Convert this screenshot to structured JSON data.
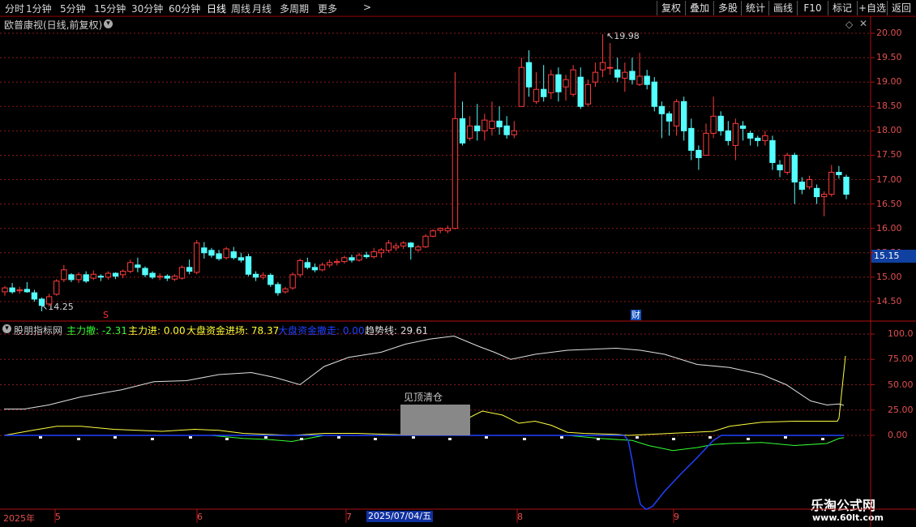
{
  "toolbar": {
    "periods": [
      "分时",
      "1分钟",
      "5分钟",
      "15分钟",
      "30分钟",
      "60分钟",
      "日线",
      "周线",
      "月线",
      "多周期",
      "更多"
    ],
    "active": "日线",
    "more_arrow": ">",
    "right_buttons": [
      "复权",
      "叠加",
      "多股",
      "统计",
      "画线",
      "F10",
      "标记",
      "+自选",
      "返回"
    ]
  },
  "main_chart": {
    "title": "欧普康视(日线,前复权)",
    "price_axis": [
      "20.00",
      "19.50",
      "19.00",
      "18.50",
      "18.00",
      "17.50",
      "17.00",
      "16.50",
      "16.00",
      "15.50",
      "15.00",
      "14.50"
    ],
    "current_price": "15.15",
    "high_label": "19.98",
    "low_label": "14.25",
    "badge_fin": "财",
    "badge_s": "S"
  },
  "indicator": {
    "name": "股朋指标网",
    "items": [
      {
        "label": "主力撤:",
        "value": "-2.31",
        "color": "#33ff33"
      },
      {
        "label": "主力进:",
        "value": "0.00",
        "color": "#ffff33"
      },
      {
        "label": "大盘资金进场:",
        "value": "78.37",
        "color": "#ffff33"
      },
      {
        "label": "大盘资金撤走:",
        "value": "0.00",
        "color": "#2040ff"
      },
      {
        "label": "趋势线:",
        "value": "29.61",
        "color": "#e0e0e0"
      }
    ],
    "axis": [
      "100.0",
      "75.00",
      "50.00",
      "25.00",
      "0.00"
    ],
    "signal_text": "见顶清仓"
  },
  "x_axis": {
    "labels": [
      "2025年",
      "5",
      "6",
      "7",
      "8",
      "9"
    ],
    "selected_date": "2025/07/04/五"
  },
  "watermark": {
    "title": "乐淘公式网",
    "url": "www.60lt.com"
  },
  "colors": {
    "up": "#ff3b3b",
    "down": "#54ffff",
    "grid": "#8a1a1a",
    "trend": "#e0e0e0"
  },
  "chart_data": {
    "type": "candlestick",
    "title": "欧普康视(日线,前复权)",
    "ylim": [
      14.1,
      20.25
    ],
    "candles": [
      [
        14.7,
        14.78,
        14.82,
        14.62
      ],
      [
        14.78,
        14.7,
        14.88,
        14.66
      ],
      [
        14.72,
        14.74,
        14.8,
        14.66
      ],
      [
        14.75,
        14.7,
        14.9,
        14.68
      ],
      [
        14.68,
        14.55,
        14.74,
        14.5
      ],
      [
        14.55,
        14.42,
        14.58,
        14.3
      ],
      [
        14.45,
        14.6,
        14.66,
        14.4
      ],
      [
        14.65,
        14.92,
        14.96,
        14.62
      ],
      [
        14.95,
        15.15,
        15.25,
        14.9
      ],
      [
        15.05,
        14.95,
        15.08,
        14.9
      ],
      [
        14.95,
        15.05,
        15.1,
        14.88
      ],
      [
        15.05,
        14.92,
        15.12,
        14.88
      ],
      [
        14.98,
        15.06,
        15.14,
        14.94
      ],
      [
        15.02,
        15.0,
        15.06,
        14.92
      ],
      [
        15.0,
        15.08,
        15.12,
        14.95
      ],
      [
        15.08,
        15.02,
        15.1,
        14.96
      ],
      [
        15.05,
        15.12,
        15.16,
        14.98
      ],
      [
        15.12,
        15.3,
        15.36,
        15.08
      ],
      [
        15.25,
        15.2,
        15.4,
        15.1
      ],
      [
        15.18,
        15.05,
        15.22,
        15.0
      ],
      [
        15.08,
        15.0,
        15.12,
        14.96
      ],
      [
        15.0,
        15.02,
        15.08,
        14.94
      ],
      [
        15.02,
        14.98,
        15.06,
        14.92
      ],
      [
        14.96,
        15.02,
        15.06,
        14.92
      ],
      [
        14.98,
        15.2,
        15.24,
        14.95
      ],
      [
        15.2,
        15.12,
        15.36,
        15.06
      ],
      [
        15.1,
        15.7,
        15.76,
        15.06
      ],
      [
        15.6,
        15.5,
        15.72,
        15.38
      ],
      [
        15.55,
        15.45,
        15.6,
        15.4
      ],
      [
        15.48,
        15.38,
        15.56,
        15.34
      ],
      [
        15.4,
        15.58,
        15.62,
        15.36
      ],
      [
        15.52,
        15.4,
        15.62,
        15.36
      ],
      [
        15.4,
        15.35,
        15.5,
        15.3
      ],
      [
        15.42,
        15.06,
        15.48,
        15.02
      ],
      [
        15.06,
        15.0,
        15.12,
        14.92
      ],
      [
        15.0,
        15.04,
        15.1,
        14.95
      ],
      [
        15.04,
        14.85,
        15.08,
        14.8
      ],
      [
        14.85,
        14.68,
        14.9,
        14.62
      ],
      [
        14.7,
        14.76,
        14.8,
        14.66
      ],
      [
        14.78,
        15.05,
        15.1,
        14.74
      ],
      [
        15.05,
        15.34,
        15.38,
        15.0
      ],
      [
        15.3,
        15.2,
        15.4,
        15.16
      ],
      [
        15.2,
        15.15,
        15.28,
        15.1
      ],
      [
        15.15,
        15.25,
        15.3,
        15.12
      ],
      [
        15.25,
        15.3,
        15.36,
        15.2
      ],
      [
        15.3,
        15.32,
        15.38,
        15.24
      ],
      [
        15.32,
        15.4,
        15.44,
        15.28
      ],
      [
        15.4,
        15.35,
        15.46,
        15.3
      ],
      [
        15.35,
        15.45,
        15.5,
        15.32
      ],
      [
        15.45,
        15.42,
        15.52,
        15.38
      ],
      [
        15.42,
        15.52,
        15.6,
        15.38
      ],
      [
        15.5,
        15.56,
        15.6,
        15.4
      ],
      [
        15.55,
        15.7,
        15.76,
        15.5
      ],
      [
        15.6,
        15.64,
        15.7,
        15.54
      ],
      [
        15.64,
        15.7,
        15.74,
        15.58
      ],
      [
        15.7,
        15.62,
        15.72,
        15.36
      ],
      [
        15.56,
        15.62,
        15.66,
        15.52
      ],
      [
        15.62,
        15.84,
        15.88,
        15.6
      ],
      [
        15.84,
        15.95,
        15.98,
        15.82
      ],
      [
        15.96,
        16.0,
        16.02,
        15.9
      ],
      [
        15.95,
        16.0,
        16.06,
        15.9
      ],
      [
        16.0,
        18.25,
        19.2,
        15.98
      ],
      [
        18.25,
        17.75,
        18.6,
        17.7
      ],
      [
        17.85,
        18.1,
        18.3,
        17.8
      ],
      [
        18.1,
        18.0,
        18.55,
        17.8
      ],
      [
        18.0,
        18.22,
        18.35,
        17.8
      ],
      [
        18.05,
        18.2,
        18.6,
        17.9
      ],
      [
        18.2,
        18.08,
        18.5,
        17.92
      ],
      [
        18.1,
        17.92,
        18.3,
        17.84
      ],
      [
        17.92,
        18.0,
        18.2,
        17.85
      ],
      [
        18.5,
        19.3,
        19.5,
        18.5
      ],
      [
        19.4,
        18.9,
        19.65,
        18.7
      ],
      [
        18.6,
        18.85,
        19.2,
        18.55
      ],
      [
        18.85,
        18.7,
        19.35,
        18.6
      ],
      [
        18.78,
        19.15,
        19.25,
        18.65
      ],
      [
        19.15,
        18.8,
        19.3,
        18.6
      ],
      [
        18.9,
        19.05,
        19.15,
        18.62
      ],
      [
        18.75,
        19.25,
        19.35,
        18.7
      ],
      [
        19.1,
        18.5,
        19.3,
        18.45
      ],
      [
        18.55,
        18.95,
        19.05,
        18.5
      ],
      [
        19.0,
        19.2,
        19.4,
        18.9
      ],
      [
        19.25,
        19.4,
        19.98,
        19.1
      ],
      [
        19.3,
        19.3,
        19.8,
        19.15
      ],
      [
        19.25,
        19.1,
        19.5,
        19.0
      ],
      [
        19.08,
        19.2,
        19.4,
        18.8
      ],
      [
        19.22,
        19.05,
        19.5,
        18.95
      ],
      [
        18.95,
        19.12,
        19.6,
        18.92
      ],
      [
        19.12,
        18.95,
        19.25,
        18.85
      ],
      [
        19.0,
        18.5,
        19.1,
        18.4
      ],
      [
        18.5,
        18.35,
        18.6,
        17.85
      ],
      [
        18.35,
        18.2,
        18.4,
        17.9
      ],
      [
        18.1,
        18.6,
        18.65,
        17.9
      ],
      [
        18.6,
        18.0,
        18.7,
        17.8
      ],
      [
        18.05,
        17.6,
        18.25,
        17.4
      ],
      [
        17.6,
        17.45,
        17.7,
        17.2
      ],
      [
        17.5,
        17.95,
        18.15,
        17.5
      ],
      [
        17.95,
        18.3,
        18.7,
        17.85
      ],
      [
        18.3,
        18.0,
        18.4,
        17.9
      ],
      [
        18.0,
        17.8,
        18.2,
        17.7
      ],
      [
        17.7,
        18.15,
        18.25,
        17.4
      ],
      [
        18.1,
        18.05,
        18.2,
        17.8
      ],
      [
        17.95,
        17.85,
        18.0,
        17.7
      ],
      [
        17.85,
        17.8,
        17.9,
        17.68
      ],
      [
        17.8,
        17.9,
        18.0,
        17.7
      ],
      [
        17.8,
        17.35,
        17.9,
        17.2
      ],
      [
        17.3,
        17.2,
        17.4,
        17.05
      ],
      [
        17.15,
        17.5,
        17.55,
        17.1
      ],
      [
        17.5,
        16.95,
        17.55,
        16.5
      ],
      [
        16.95,
        16.8,
        17.05,
        16.7
      ],
      [
        16.85,
        17.0,
        17.08,
        16.8
      ],
      [
        16.82,
        16.65,
        16.9,
        16.5
      ],
      [
        16.65,
        16.7,
        16.76,
        16.25
      ],
      [
        16.7,
        17.15,
        17.3,
        16.65
      ],
      [
        17.15,
        17.1,
        17.28,
        17.02
      ],
      [
        17.05,
        16.7,
        17.1,
        16.6
      ]
    ],
    "indicator_axis": [
      0,
      100
    ],
    "trend_line_tail": 29.61,
    "series_latest": {
      "主力撤": -2.31,
      "主力进": 0.0,
      "大盘资金进场": 78.37,
      "大盘资金撤走": 0.0,
      "趋势线": 29.61
    }
  }
}
